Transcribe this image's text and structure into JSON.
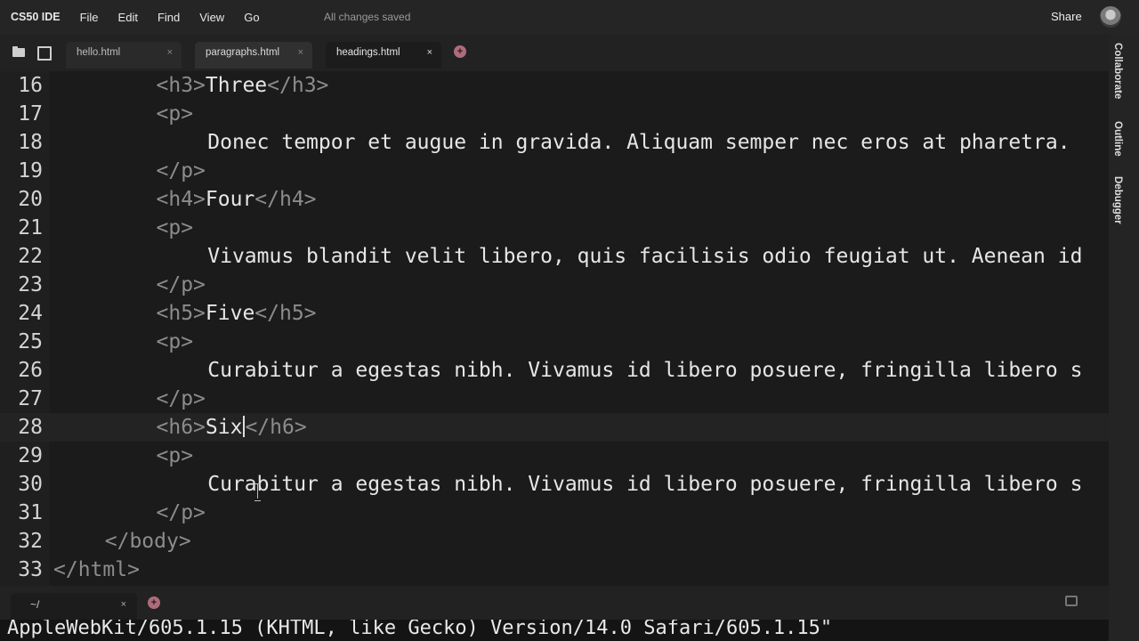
{
  "menubar": {
    "brand": "CS50 IDE",
    "items": [
      "File",
      "Edit",
      "Find",
      "View",
      "Go"
    ],
    "status": "All changes saved",
    "share": "Share"
  },
  "tabs": [
    {
      "label": "hello.html",
      "close": "×"
    },
    {
      "label": "paragraphs.html",
      "close": "×"
    },
    {
      "label": "headings.html",
      "close": "×"
    }
  ],
  "plus": "+",
  "editor": {
    "current_line": 28,
    "lines": [
      {
        "n": "16",
        "indent": 2,
        "tag1": "<h3>",
        "text": "Three",
        "tag2": "</h3>"
      },
      {
        "n": "17",
        "indent": 2,
        "tag1": "<p>",
        "text": "",
        "tag2": ""
      },
      {
        "n": "18",
        "indent": 3,
        "tag1": "",
        "text": "Donec tempor et augue in gravida. Aliquam semper nec eros at pharetra. ",
        "tag2": ""
      },
      {
        "n": "19",
        "indent": 2,
        "tag1": "</p>",
        "text": "",
        "tag2": ""
      },
      {
        "n": "20",
        "indent": 2,
        "tag1": "<h4>",
        "text": "Four",
        "tag2": "</h4>"
      },
      {
        "n": "21",
        "indent": 2,
        "tag1": "<p>",
        "text": "",
        "tag2": ""
      },
      {
        "n": "22",
        "indent": 3,
        "tag1": "",
        "text": "Vivamus blandit velit libero, quis facilisis odio feugiat ut. Aenean id",
        "tag2": ""
      },
      {
        "n": "23",
        "indent": 2,
        "tag1": "</p>",
        "text": "",
        "tag2": ""
      },
      {
        "n": "24",
        "indent": 2,
        "tag1": "<h5>",
        "text": "Five",
        "tag2": "</h5>"
      },
      {
        "n": "25",
        "indent": 2,
        "tag1": "<p>",
        "text": "",
        "tag2": ""
      },
      {
        "n": "26",
        "indent": 3,
        "tag1": "",
        "text": "Curabitur a egestas nibh. Vivamus id libero posuere, fringilla libero s",
        "tag2": ""
      },
      {
        "n": "27",
        "indent": 2,
        "tag1": "</p>",
        "text": "",
        "tag2": ""
      },
      {
        "n": "28",
        "indent": 2,
        "tag1": "<h6>",
        "text": "Six",
        "tag2": "</h6>"
      },
      {
        "n": "29",
        "indent": 2,
        "tag1": "<p>",
        "text": "",
        "tag2": ""
      },
      {
        "n": "30",
        "indent": 3,
        "tag1": "",
        "text": "Curabitur a egestas nibh. Vivamus id libero posuere, fringilla libero s",
        "tag2": ""
      },
      {
        "n": "31",
        "indent": 2,
        "tag1": "</p>",
        "text": "",
        "tag2": ""
      },
      {
        "n": "32",
        "indent": 1,
        "tag1": "</body>",
        "text": "",
        "tag2": ""
      },
      {
        "n": "33",
        "indent": 0,
        "tag1": "</html>",
        "text": "",
        "tag2": ""
      }
    ]
  },
  "sidepanel": {
    "tabs": [
      "Collaborate",
      "Outline",
      "Debugger"
    ]
  },
  "terminal": {
    "tab_label": "~/",
    "close": "×",
    "output": "AppleWebKit/605.1.15 (KHTML, like Gecko) Version/14.0 Safari/605.1.15\""
  },
  "icons": [
    "folder-icon",
    "files-icon",
    "avatar",
    "gear-icon"
  ]
}
